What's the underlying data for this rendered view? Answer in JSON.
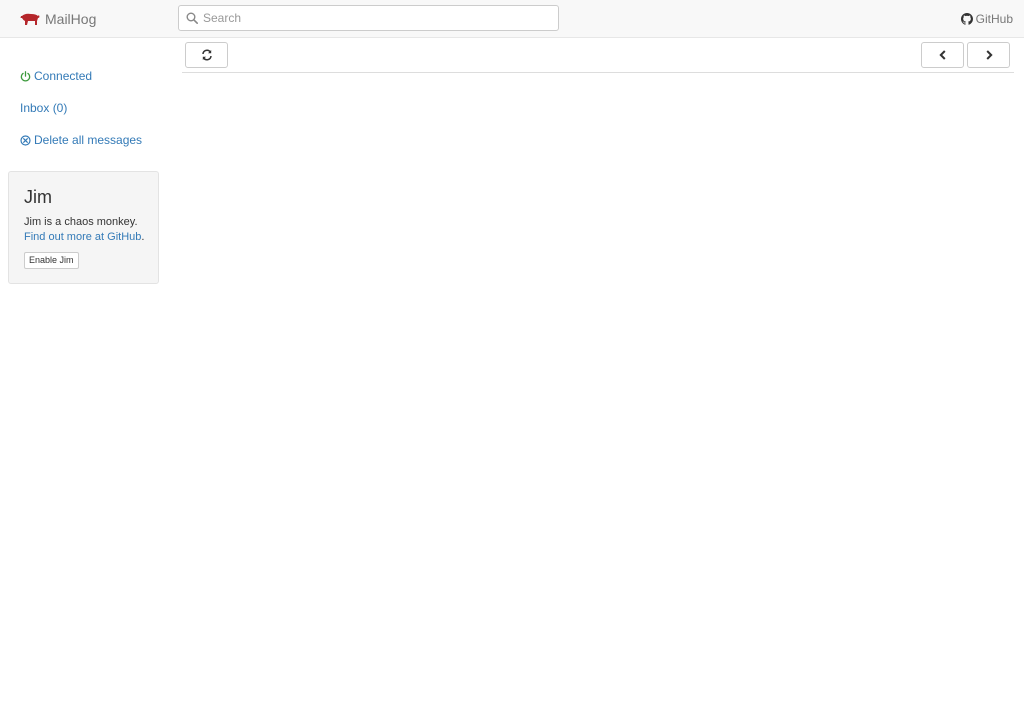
{
  "navbar": {
    "brand": "MailHog",
    "brand_icon": "mailhog-pig-logo",
    "search": {
      "placeholder": "Search",
      "value": ""
    },
    "github_label": "GitHub"
  },
  "sidebar": {
    "connection_status": "Connected",
    "connection_status_color": "#3c9a3c",
    "inbox_label": "Inbox (0)",
    "delete_all_label": "Delete all messages"
  },
  "jim": {
    "title": "Jim",
    "description": "Jim is a chaos monkey.",
    "link_text": "Find out more at GitHub",
    "link_suffix": ".",
    "button_label": "Enable Jim"
  },
  "toolbar": {
    "refresh_icon": "refresh-icon",
    "prev_icon": "chevron-left-icon",
    "next_icon": "chevron-right-icon"
  },
  "colors": {
    "link": "#337ab7",
    "navbar_bg": "#f8f8f8",
    "logo": "#b5262b"
  }
}
